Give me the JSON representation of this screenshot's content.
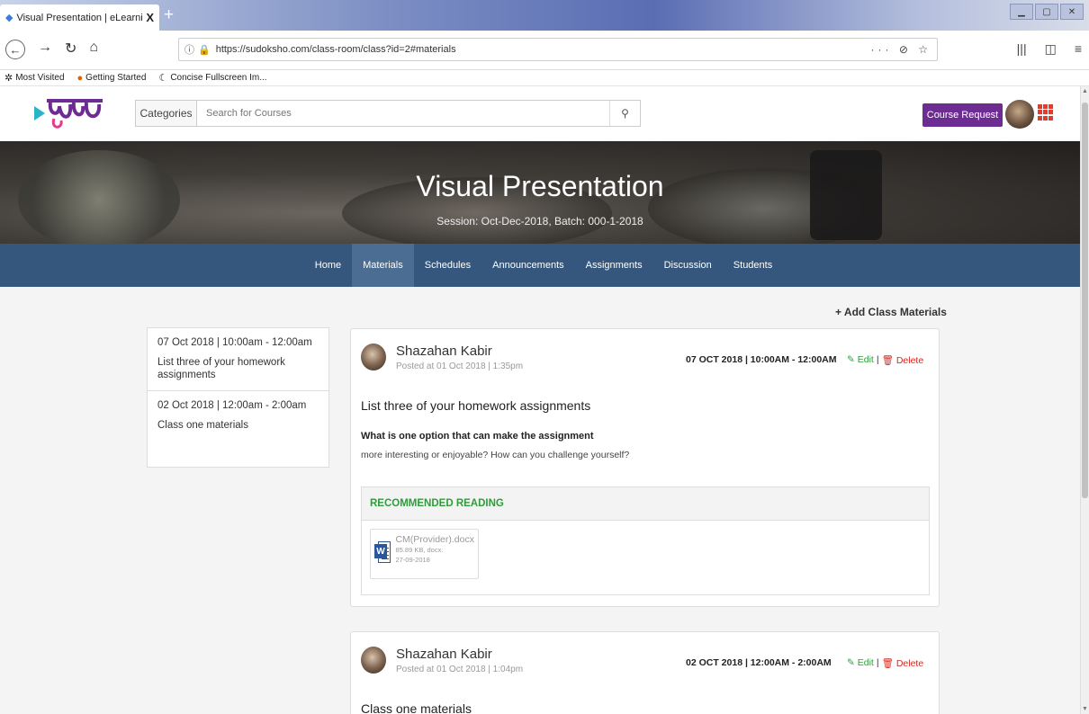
{
  "browser": {
    "tab_title": "Visual Presentation | eLearning",
    "tab_close": "X",
    "new_tab": "+",
    "url": "https://sudoksho.com/class-room/class?id=2#materials",
    "url_right": "··· ⊘ ☆",
    "bookmarks": [
      {
        "label": "Most Visited",
        "icon": "gear-icon"
      },
      {
        "label": "Getting Started",
        "icon": "firefox-icon"
      },
      {
        "label": "Concise Fullscreen Im...",
        "icon": "concise-icon"
      }
    ]
  },
  "header": {
    "categories_label": "Categories",
    "search_placeholder": "Search for Courses",
    "course_request_label": "Course Request",
    "accent_color": "#6c2c92"
  },
  "hero": {
    "title": "Visual Presentation",
    "subtitle": "Session: Oct-Dec-2018, Batch: 000-1-2018"
  },
  "classnav": {
    "items": [
      "Home",
      "Materials",
      "Schedules",
      "Announcements",
      "Assignments",
      "Discussion",
      "Students"
    ],
    "active": "Materials",
    "color": "#35577d"
  },
  "add_materials_label": "+ Add Class Materials",
  "sidebar": {
    "items": [
      {
        "date": "07 Oct 2018 | 10:00am - 12:00am",
        "title": "List three of your homework assignments"
      },
      {
        "date": "02 Oct 2018 | 12:00am - 2:00am",
        "title": "Class one materials"
      }
    ]
  },
  "materials": [
    {
      "author": "Shazahan Kabir",
      "posted": "Posted at 01 Oct 2018 | 1:35pm",
      "when": "07 OCT 2018 | 10:00AM - 12:00AM",
      "edit_label": "Edit",
      "separator": "|",
      "delete_label": "Delete",
      "heading": "List three of your homework assignments",
      "question": "What is one option that can make the assignment",
      "answer": "more interesting or enjoyable? How can you challenge yourself?",
      "reading_heading": "RECOMMENDED READING",
      "file": {
        "name": "CM(Provider).docx",
        "meta": "85.89 KB, docx.",
        "date": "27-09-2018",
        "icon_letter": "W"
      }
    },
    {
      "author": "Shazahan Kabir",
      "posted": "Posted at 01 Oct 2018 | 1:04pm",
      "when": "02 OCT 2018 | 12:00AM - 2:00AM",
      "edit_label": "Edit",
      "separator": "|",
      "delete_label": "Delete",
      "heading": "Class one materials"
    }
  ]
}
